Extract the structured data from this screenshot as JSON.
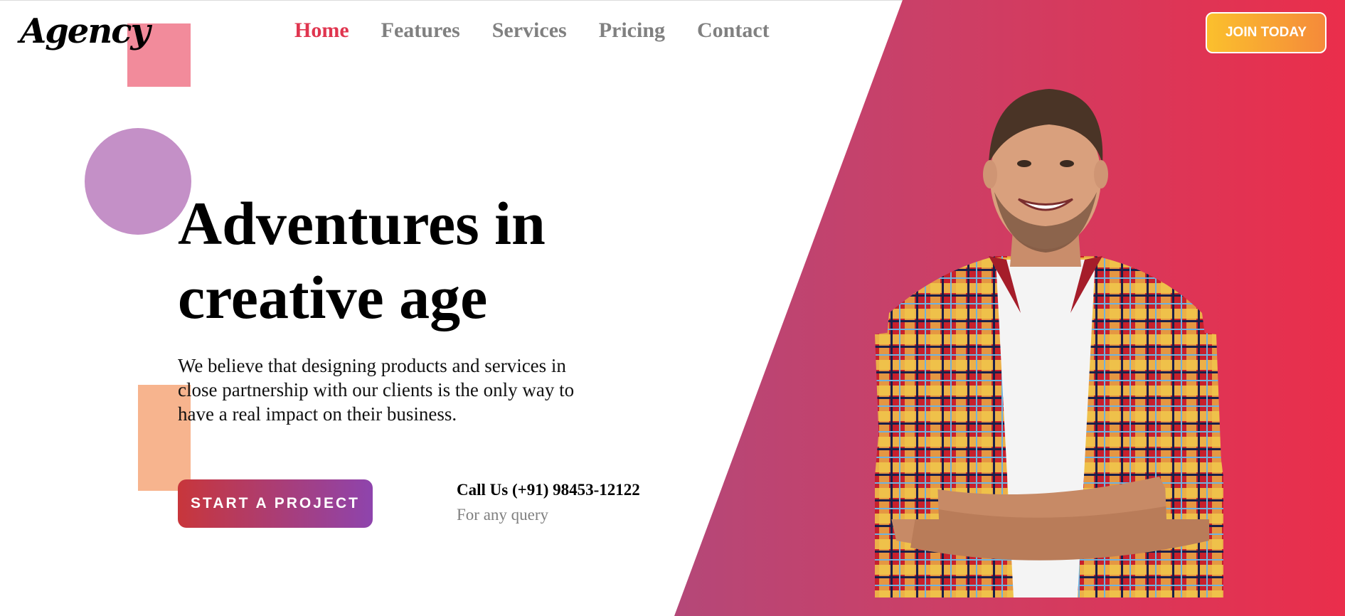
{
  "brand": {
    "logo_text": "Agency"
  },
  "nav": {
    "items": [
      {
        "label": "Home",
        "active": true
      },
      {
        "label": "Features",
        "active": false
      },
      {
        "label": "Services",
        "active": false
      },
      {
        "label": "Pricing",
        "active": false
      },
      {
        "label": "Contact",
        "active": false
      }
    ]
  },
  "header": {
    "join_label": "JOIN TODAY"
  },
  "hero": {
    "title_line1": "Adventures in",
    "title_line2": "creative age",
    "description_line1": "We believe that designing products and services in",
    "description_line2": "close partnership with our clients is the only way to",
    "description_line3": "have a real impact on their business.",
    "cta_label": "START A PROJECT",
    "call_text": "Call Us (+91) 98453-12122",
    "query_text": "For any query"
  },
  "colors": {
    "accent": "#e0354f",
    "gradient_start": "#6f66b0",
    "gradient_end": "#ea2e4b",
    "join_button_start": "#fbc02d",
    "join_button_end": "#f58a3a"
  },
  "icons": {
    "hero_image": "smiling-man-plaid-shirt-icon"
  }
}
